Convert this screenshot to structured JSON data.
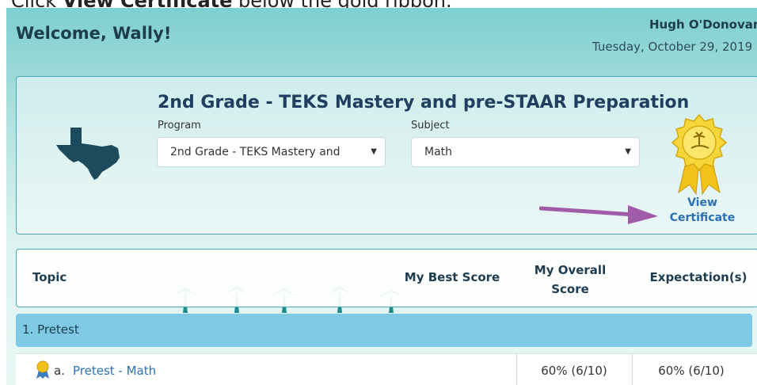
{
  "instruction": {
    "prefix": "Click ",
    "bold": "View Certificate",
    "suffix": " below the gold ribbon."
  },
  "header": {
    "welcome": "Welcome, Wally!",
    "user_name": "Hugh O'Donovan",
    "date": "Tuesday, October 29, 2019"
  },
  "program_card": {
    "title": "2nd Grade - TEKS Mastery and pre-STAAR Preparation",
    "program_label": "Program",
    "program_value": "2nd Grade - TEKS Mastery and",
    "subject_label": "Subject",
    "subject_value": "Math",
    "view_certificate_line1": "View",
    "view_certificate_line2": "Certificate"
  },
  "table": {
    "columns": {
      "topic": "Topic",
      "best_score": "My Best Score",
      "overall_score_line1": "My Overall",
      "overall_score_line2": "Score",
      "expectations": "Expectation(s)"
    },
    "sections": [
      {
        "label": "1. Pretest",
        "rows": [
          {
            "prefix": "a.",
            "topic": "Pretest - Math",
            "best_score": "",
            "overall_score": "60% (6/10)",
            "expectations": "60% (6/10)"
          }
        ]
      }
    ]
  },
  "colors": {
    "accent_link": "#2a6fb8",
    "section_bar": "#7ec9e4",
    "gold": "#f2c21b",
    "arrow": "#a05ca8"
  },
  "icons": [
    "texas-map-icon",
    "gold-medal-icon",
    "annotation-arrow",
    "small-ribbon-icon",
    "dropdown-caret-icon"
  ]
}
